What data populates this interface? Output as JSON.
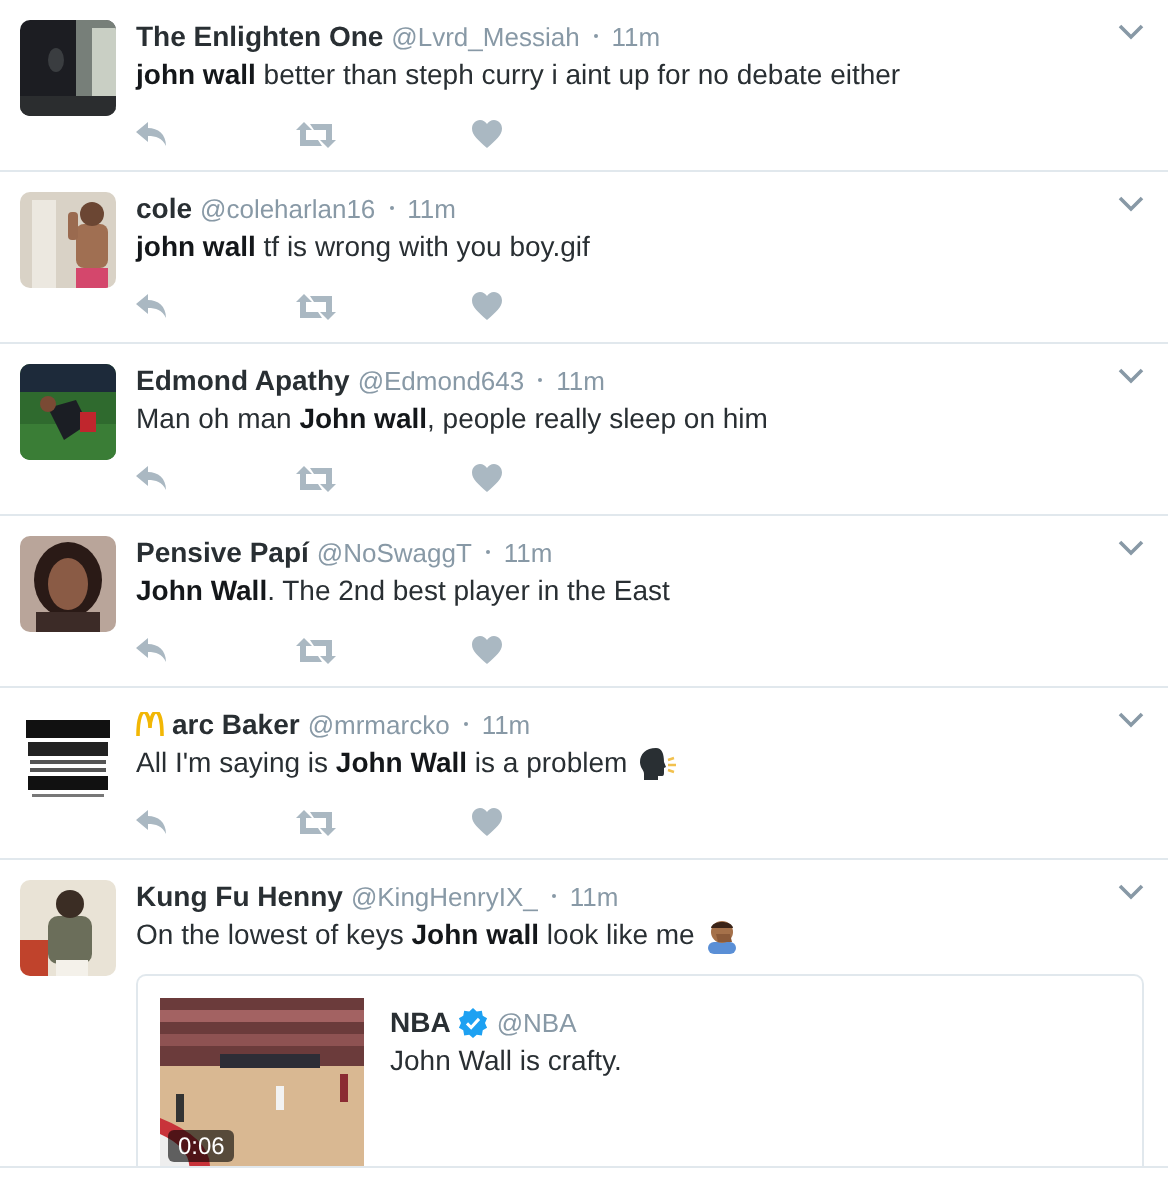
{
  "tweets": [
    {
      "name": "The Enlighten One",
      "handle": "@Lvrd_Messiah",
      "time": "11m",
      "text": "**john wall** better than steph curry i aint up for no debate either"
    },
    {
      "name": "cole",
      "handle": "@coleharlan16",
      "time": "11m",
      "text": "**john wall** tf is wrong with you boy.gif"
    },
    {
      "name": "Edmond Apathy",
      "handle": "@Edmond643",
      "time": "11m",
      "text": "Man oh man **John wall**, people really sleep on him"
    },
    {
      "name": "Pensive Papí",
      "handle": "@NoSwaggT",
      "time": "11m",
      "text": "**John Wall**. The 2nd best player in the East"
    },
    {
      "name": "arc Baker",
      "name_icon": {
        "kind": "arches"
      },
      "handle": "@mrmarcko",
      "time": "11m",
      "text": "All I'm saying is **John Wall** is a problem",
      "emoji": {
        "kind": "speaking-head"
      }
    },
    {
      "name": "Kung Fu Henny",
      "handle": "@KingHenryIX_",
      "time": "11m",
      "text": "On the lowest of keys **John wall** look like me",
      "emoji": {
        "kind": "facepalm"
      },
      "quote": {
        "name": "NBA",
        "verified": true,
        "handle": "@NBA",
        "text": "John Wall is crafty.",
        "video": {
          "kind": "picture",
          "duration": "0:06"
        }
      }
    }
  ]
}
